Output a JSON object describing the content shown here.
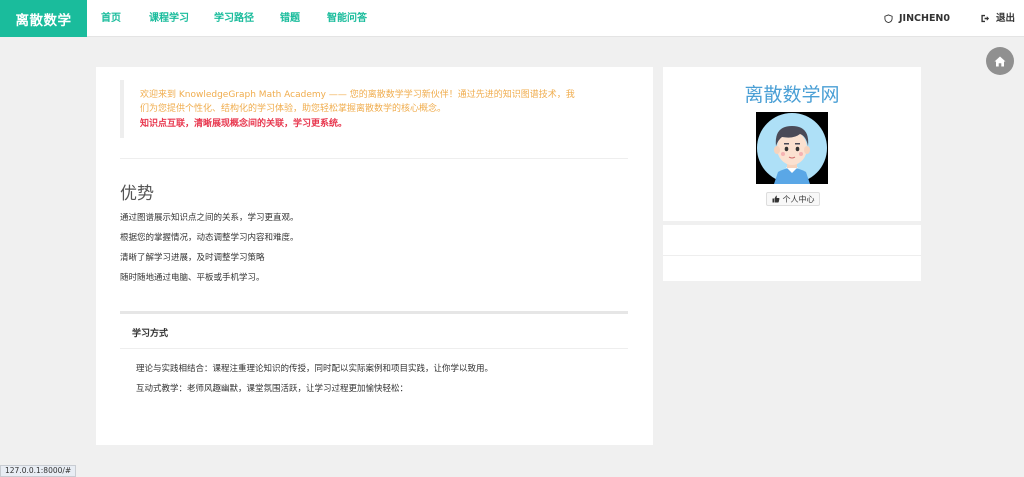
{
  "navbar": {
    "brand": "离散数学",
    "items": [
      "首页",
      "课程学习",
      "学习路径",
      "错题",
      "智能问答"
    ],
    "user": "JINCHEN0",
    "logout": "退出"
  },
  "welcome": {
    "line1": "欢迎来到 KnowledgeGraph Math Academy —— 您的离散数学学习新伙伴！通过先进的知识图谱技术，我",
    "line2": "们为您提供个性化、结构化的学习体验，助您轻松掌握离散数学的核心概念。",
    "highlight": "知识点互联，清晰展现概念间的关联，学习更系统。"
  },
  "advantages": {
    "title": "优势",
    "items": [
      "通过图谱展示知识点之间的关系，学习更直观。",
      "根据您的掌握情况，动态调整学习内容和难度。",
      "清晰了解学习进展，及时调整学习策略",
      "随时随地通过电脑、平板或手机学习。"
    ]
  },
  "study": {
    "heading": "学习方式",
    "items": [
      "理论与实践相结合：课程注重理论知识的传授，同时配以实际案例和项目实践，让你学以致用。",
      "互动式教学：老师风趣幽默，课堂氛围活跃，让学习过程更加愉快轻松："
    ]
  },
  "sidebar": {
    "title": "离散数学网",
    "profile_button": "个人中心"
  },
  "status_url": "127.0.0.1:8000/#",
  "colors": {
    "brand": "#1abc9c",
    "welcome": "#f0ad4e",
    "highlight": "#e8384f",
    "side_title": "#4a9fd5"
  }
}
